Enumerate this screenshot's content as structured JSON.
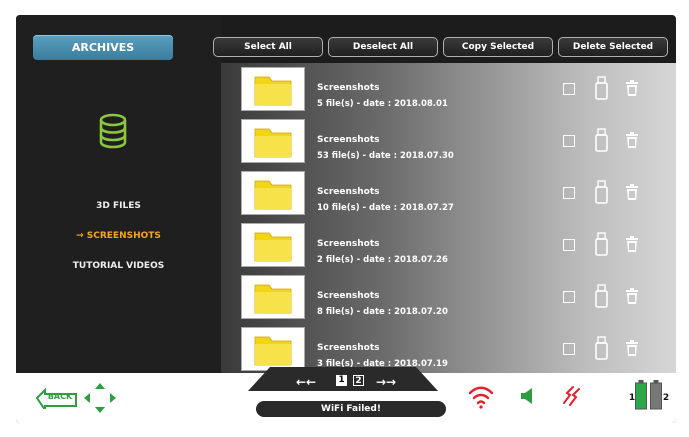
{
  "sidebar": {
    "tab_label": "ARCHIVES",
    "items": [
      {
        "label": "3D FILES"
      },
      {
        "label": "→ SCREENSHOTS"
      },
      {
        "label": "TUTORIAL VIDEOS"
      }
    ]
  },
  "toolbar": {
    "select_all": "Select All",
    "deselect_all": "Deselect All",
    "copy_selected": "Copy Selected",
    "delete_selected": "Delete Selected"
  },
  "files": [
    {
      "title": "Screenshots",
      "info": "5 file(s) - date : 2018.08.01"
    },
    {
      "title": "Screenshots",
      "info": "53 file(s) - date : 2018.07.30"
    },
    {
      "title": "Screenshots",
      "info": "10 file(s) - date : 2018.07.27"
    },
    {
      "title": "Screenshots",
      "info": "2 file(s) - date : 2018.07.26"
    },
    {
      "title": "Screenshots",
      "info": "8 file(s) - date : 2018.07.20"
    },
    {
      "title": "Screenshots",
      "info": "3 file(s) - date : 2018.07.19"
    }
  ],
  "footer": {
    "back_label": "BACK",
    "pages": [
      "1",
      "2"
    ],
    "wifi_status": "WiFi Failed!",
    "battery_labels": [
      "1",
      "2"
    ]
  },
  "colors": {
    "accent_tab": "#3b7c9c",
    "active_nav": "#f5a623",
    "db_icon": "#8cc63f",
    "wifi_error": "#e0202a",
    "green": "#2e9e3e"
  }
}
